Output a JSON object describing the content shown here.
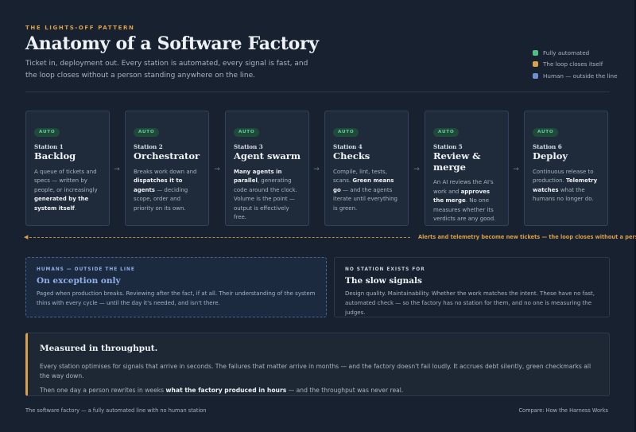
{
  "header": {
    "eyebrow": "THE LIGHTS-OFF PATTERN",
    "title": "Anatomy of a Software Factory",
    "subtitle": "Ticket in, deployment out. Every station is automated, every signal is fast, and the loop closes without a person standing anywhere on the line."
  },
  "legend": [
    {
      "label": "Fully automated",
      "color": "#4fbf8a"
    },
    {
      "label": "The loop closes itself",
      "color": "#d9a14a"
    },
    {
      "label": "Human — outside the line",
      "color": "#6f8fd0"
    }
  ],
  "stations": [
    {
      "badge": "AUTO",
      "num": "Station 1",
      "name": "Backlog",
      "desc": [
        {
          "t": "A queue of tickets and specs — written by people, or increasingly "
        },
        {
          "t": "generated by the system itself",
          "b": true
        },
        {
          "t": "."
        }
      ]
    },
    {
      "badge": "AUTO",
      "num": "Station 2",
      "name": "Orchestrator",
      "desc": [
        {
          "t": "Breaks work down and "
        },
        {
          "t": "dispatches it to agents",
          "b": true
        },
        {
          "t": " — deciding scope, order and priority on its own."
        }
      ]
    },
    {
      "badge": "AUTO",
      "num": "Station 3",
      "name": "Agent swarm",
      "desc": [
        {
          "t": "Many agents in parallel",
          "b": true
        },
        {
          "t": ", generating code around the clock. Volume is the point — output is effectively free."
        }
      ]
    },
    {
      "badge": "AUTO",
      "num": "Station 4",
      "name": "Checks",
      "desc": [
        {
          "t": "Compile, lint, tests, scans. "
        },
        {
          "t": "Green means go",
          "b": true
        },
        {
          "t": " — and the agents iterate until everything is green."
        }
      ]
    },
    {
      "badge": "AUTO",
      "num": "Station 5",
      "name": "Review & merge",
      "desc": [
        {
          "t": "An AI reviews the AI's work and "
        },
        {
          "t": "approves the merge",
          "b": true
        },
        {
          "t": ". No one measures whether its verdicts are any good."
        }
      ]
    },
    {
      "badge": "AUTO",
      "num": "Station 6",
      "name": "Deploy",
      "desc": [
        {
          "t": "Continuous release to production. "
        },
        {
          "t": "Telemetry watches",
          "b": true
        },
        {
          "t": " what the humans no longer do."
        }
      ]
    }
  ],
  "arrow_glyph": "→",
  "loop": {
    "arrowhead": "◀",
    "text": "Alerts and telemetry become new tickets — the loop closes without a person"
  },
  "human_panel": {
    "eyebrow": "HUMANS — OUTSIDE THE LINE",
    "title": "On exception only",
    "body": "Paged when production breaks. Reviewing after the fact, if at all. Their understanding of the system thins with every cycle — until the day it's needed, and isn't there.",
    "accent": "#8fb0e8"
  },
  "slow_panel": {
    "eyebrow": "NO STATION EXISTS FOR",
    "title": "The slow signals",
    "body": "Design quality. Maintainability. Whether the work matches the intent. These have no fast, automated check — so the factory has no station for them, and no one is measuring the judges."
  },
  "callout": {
    "title": "Measured in throughput.",
    "p1": "Every station optimises for signals that arrive in seconds. The failures that matter arrive in months — and the factory doesn't fail loudly. It accrues debt silently, green checkmarks all the way down.",
    "p2_pre": "Then one day a person rewrites in weeks ",
    "p2_bold": "what the factory produced in hours",
    "p2_post": " — and the throughput was never real."
  },
  "footer": {
    "left": "The software factory — a fully automated line with no human station",
    "right": "Compare: How the Harness Works"
  }
}
